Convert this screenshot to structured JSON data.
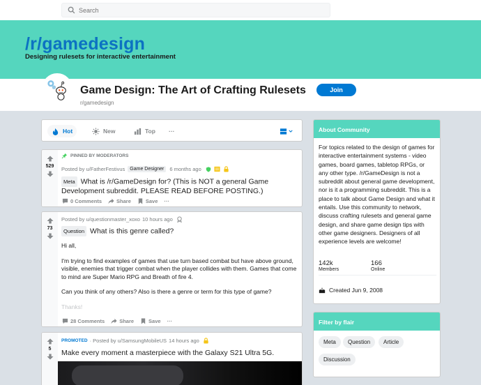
{
  "search": {
    "placeholder": "Search"
  },
  "banner": {
    "title": "/r/gamedesign",
    "subtitle": "Designing rulesets for interactive entertainment"
  },
  "subreddit": {
    "title": "Game Design: The Art of Crafting Rulesets",
    "name": "r/gamedesign",
    "join_label": "Join"
  },
  "sort": {
    "hot": "Hot",
    "new": "New",
    "top": "Top",
    "more": "···"
  },
  "posts": [
    {
      "pinned_label": "PINNED BY MODERATORS",
      "score": "529",
      "posted_by": "Posted by u/FatherFestivus",
      "user_flair": "Game Designer",
      "time": "6 months ago",
      "flair": "Meta",
      "title": "What is /r/GameDesign for? (This is NOT a general Game Development subreddit. PLEASE READ BEFORE POSTING.)",
      "comments": "0 Comments",
      "share": "Share",
      "save": "Save",
      "more": "···"
    },
    {
      "score": "73",
      "posted_by": "Posted by u/questionmaster_xoxo",
      "time": "10 hours ago",
      "flair": "Question",
      "title": "What is this genre called?",
      "body": [
        "Hi all,",
        "I'm trying to find examples of games that use turn based combat but have above ground, visible, enemies that trigger combat when the player collides with them. Games that come to mind are Super Mario RPG and Breath of fire 4.",
        "Can you think of any others? Also is there a genre or term for this type of game?",
        "Thanks!"
      ],
      "comments": "28 Comments",
      "share": "Share",
      "save": "Save",
      "more": "···"
    },
    {
      "score": "5",
      "promoted": "PROMOTED",
      "posted_by": "· Posted by u/SamsungMobileUS",
      "time": "14 hours ago",
      "title": "Make every moment a masterpiece with the Galaxy S21 Ultra 5G."
    }
  ],
  "about": {
    "header": "About Community",
    "description": "For topics related to the design of games for interactive entertainment systems - video games, board games, tabletop RPGs, or any other type. /r/GameDesign is not a subreddit about general game development, nor is it a programming subreddit. This is a place to talk about Game Design and what it entails. Use this community to network, discuss crafting rulesets and general game design, and share game design tips with other game designers. Designers of all experience levels are welcome!",
    "members": "142k",
    "members_label": "Members",
    "online": "166",
    "online_label": "Online",
    "created": "Created Jun 9, 2008"
  },
  "flair_filter": {
    "header": "Filter by flair",
    "chips": [
      "Meta",
      "Question",
      "Article",
      "Discussion"
    ]
  },
  "colors": {
    "accent": "#55d6be",
    "brand_blue": "#0079d3",
    "banner_title": "#0c72c2"
  }
}
